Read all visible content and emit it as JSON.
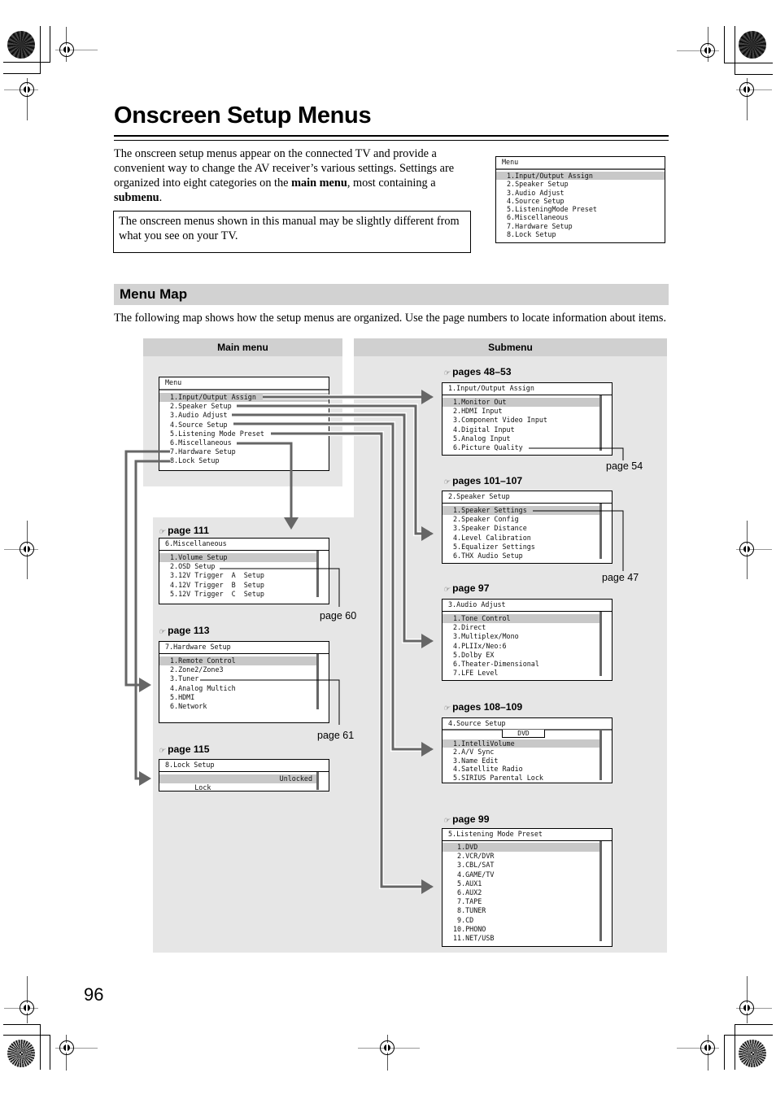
{
  "page": {
    "title": "Onscreen Setup Menus",
    "intro": {
      "part1": "The onscreen setup menus appear on the connected TV and provide a convenient way to change the AV receiver’s various settings. Settings are organized into eight categories on the ",
      "bold1": "main menu",
      "part2": ", most containing a ",
      "bold2": "submenu",
      "part3": "."
    },
    "note": "The onscreen menus shown in this manual may be slightly different  from what you see on your TV.",
    "page_number": "96"
  },
  "preview_menu": {
    "header": "Menu",
    "items": [
      "1.Input/Output Assign",
      "2.Speaker Setup",
      "3.Audio Adjust",
      "4.Source Setup",
      "5.ListeningMode Preset",
      "6.Miscellaneous",
      "7.Hardware Setup",
      "8.Lock Setup"
    ],
    "selected_index": 0
  },
  "menu_map": {
    "section_title": "Menu Map",
    "description": "The following map shows how the setup menus are organized. Use the page numbers to locate information about items.",
    "main_menu_heading": "Main menu",
    "submenu_heading": "Submenu",
    "page_ref_icon": "pointing-hand-icon",
    "main_menu": {
      "header": "Menu",
      "items": [
        "1.Input/Output Assign",
        "2.Speaker Setup",
        "3.Audio Adjust",
        "4.Source Setup",
        "5.Listening Mode Preset",
        "6.Miscellaneous",
        "7.Hardware Setup",
        "8.Lock Setup"
      ],
      "selected_index": 0
    },
    "submenus": {
      "io": {
        "page_ref": "pages 48–53",
        "header": "1.Input/Output Assign",
        "items": [
          "1.Monitor Out",
          "2.HDMI Input",
          "3.Component Video Input",
          "4.Digital Input",
          "5.Analog Input",
          "6.Picture Quality"
        ],
        "selected_index": 0,
        "callout": "page 54"
      },
      "speaker": {
        "page_ref": "pages 101–107",
        "header": "2.Speaker Setup",
        "items": [
          "1.Speaker Settings",
          "2.Speaker Config",
          "3.Speaker Distance",
          "4.Level Calibration",
          "5.Equalizer Settings",
          "6.THX Audio Setup"
        ],
        "selected_index": 0,
        "callout": "page 47"
      },
      "audio": {
        "page_ref": "page 97",
        "header": "3.Audio Adjust",
        "items": [
          "1.Tone Control",
          "2.Direct",
          "3.Multiplex/Mono",
          "4.PLIIx/Neo:6",
          "5.Dolby EX",
          "6.Theater-Dimensional",
          "7.LFE Level"
        ],
        "selected_index": 0
      },
      "source": {
        "page_ref": "pages 108–109",
        "header": "4.Source Setup",
        "input_selector": "DVD",
        "items": [
          "1.IntelliVolume",
          "2.A/V Sync",
          "3.Name Edit",
          "4.Satellite Radio",
          "5.SIRIUS Parental Lock"
        ],
        "selected_index": 0
      },
      "listening": {
        "page_ref": "page 99",
        "header": "5.Listening Mode Preset",
        "items": [
          " 1.DVD",
          " 2.VCR/DVR",
          " 3.CBL/SAT",
          " 4.GAME/TV",
          " 5.AUX1",
          " 6.AUX2",
          " 7.TAPE",
          " 8.TUNER",
          " 9.CD",
          "10.PHONO",
          "11.NET/USB"
        ],
        "selected_index": 0
      },
      "misc": {
        "page_ref": "page 111",
        "header": "6.Miscellaneous",
        "items": [
          "1.Volume Setup",
          "2.OSD Setup",
          "3.12V Trigger  A  Setup",
          "4.12V Trigger  B  Setup",
          "5.12V Trigger  C  Setup"
        ],
        "selected_index": 0,
        "callout": "page 60"
      },
      "hardware": {
        "page_ref": "page 113",
        "header": "7.Hardware Setup",
        "items": [
          "1.Remote Control",
          "2.Zone2/Zone3",
          "3.Tuner",
          "4.Analog Multich",
          "5.HDMI",
          "6.Network"
        ],
        "selected_index": 0,
        "callout": "page 61"
      },
      "lock": {
        "page_ref": "page 115",
        "header": "8.Lock Setup",
        "setting_label": "Lock",
        "setting_value": "Unlocked"
      }
    },
    "colors": {
      "panel_bg": "#e6e6e6",
      "panel_header_bg": "#d0d0d0",
      "connector": "#666666",
      "selected_row": "#c8c8c8"
    }
  }
}
